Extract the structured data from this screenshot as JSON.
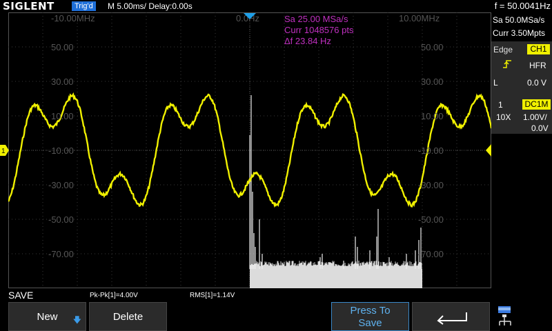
{
  "header": {
    "logo": "SIGLENT",
    "trigger_status": "Trig'd",
    "timebase": "M 5.00ms/ Delay:0.00s",
    "frequency": "f = 50.0041Hz"
  },
  "fft_info": {
    "sample_rate": "Sa 25.00 MSa/s",
    "points": "Curr 1048576 pts",
    "resolution": "Δf 23.84 Hz"
  },
  "x_axis_labels": [
    "-10.00MHz",
    "0.0Hz",
    "10.00MHz"
  ],
  "y_axis_labels": [
    "50.00",
    "30.00",
    "10.00",
    "-10.00",
    "-30.00",
    "-50.00",
    "-70.00"
  ],
  "right_panel": {
    "sample_rate": "Sa 50.0MSa/s",
    "memory_depth": "Curr 3.50Mpts",
    "trigger_type_label": "Edge",
    "trigger_source": "CH1",
    "trigger_coupling": "HFR",
    "trigger_level_label": "L",
    "trigger_level": "0.0 V",
    "channel_number": "1",
    "channel_coupling": "DC1M",
    "probe": "10X",
    "volts_per_div": "1.00V/",
    "offset": "0.0V"
  },
  "status": {
    "menu_title": "SAVE",
    "pkpk": "Pk-Pk[1]=4.00V",
    "rms": "RMS[1]=1.14V"
  },
  "softkeys": {
    "new": "New",
    "delete": "Delete",
    "press_to_save": "Press To Save"
  },
  "colors": {
    "ch1": "#f0f000",
    "fft": "#e0e0e0",
    "math_text": "#c030c0",
    "accent_blue": "#1e6fd8"
  },
  "icons": {
    "new_arrow": "arrow-down-icon",
    "return": "return-arrow-icon",
    "network": "network-icon",
    "edge": "rising-edge-icon"
  }
}
